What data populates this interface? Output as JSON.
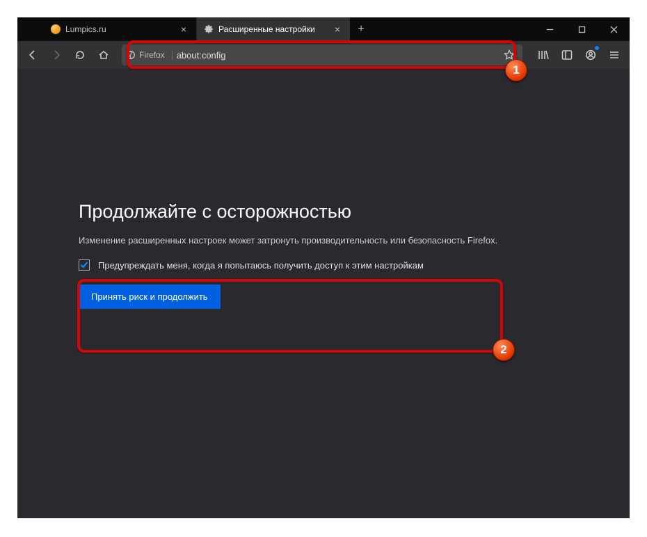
{
  "tabs": [
    {
      "title": "Lumpics.ru",
      "active": false
    },
    {
      "title": "Расширенные настройки",
      "active": true
    }
  ],
  "urlbar": {
    "identity_label": "Firefox",
    "url": "about:config"
  },
  "page": {
    "heading": "Продолжайте с осторожностью",
    "warning": "Изменение расширенных настроек может затронуть производительность или безопасность Firefox.",
    "checkbox_label": "Предупреждать меня, когда я попытаюсь получить доступ к этим настройкам",
    "accept_button": "Принять риск и продолжить",
    "checkbox_checked": true
  },
  "annotations": {
    "marker1": "1",
    "marker2": "2"
  }
}
